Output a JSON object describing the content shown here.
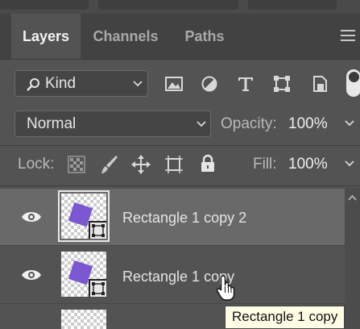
{
  "tabs": [
    {
      "label": "Layers",
      "active": true
    },
    {
      "label": "Channels",
      "active": false
    },
    {
      "label": "Paths",
      "active": false
    }
  ],
  "filter": {
    "kind_label": "Kind",
    "icons": [
      "image-filter-icon",
      "adjustment-filter-icon",
      "type-filter-icon",
      "shape-filter-icon",
      "smart-object-filter-icon"
    ]
  },
  "blend": {
    "mode": "Normal",
    "opacity_label": "Opacity:",
    "opacity_value": "100%"
  },
  "lock": {
    "label": "Lock:",
    "fill_label": "Fill:",
    "fill_value": "100%"
  },
  "layers": [
    {
      "name": "Rectangle 1 copy 2",
      "selected": true,
      "visible": true
    },
    {
      "name": "Rectangle 1 copy",
      "selected": false,
      "visible": true
    }
  ],
  "tooltip": "Rectangle 1 copy",
  "colors": {
    "panel": "#535353",
    "selected_row": "#696969",
    "shape_fill": "#7b57d1",
    "tooltip_bg": "#fffde5"
  }
}
